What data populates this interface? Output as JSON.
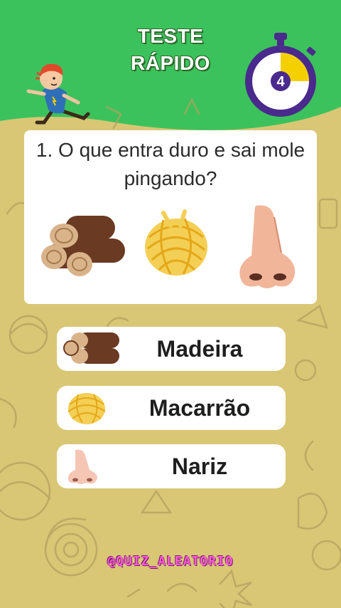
{
  "header": {
    "title_line1": "TESTE",
    "title_line2": "RÁPIDO"
  },
  "timer": {
    "value": "4",
    "progress": 0.25,
    "ring_color": "#4a2a8c",
    "fill_color": "#f5d000"
  },
  "question": {
    "text": "1. O que entra duro e sai mole pingando?",
    "images": [
      "wood-logs",
      "spaghetti-nest",
      "nose"
    ]
  },
  "answers": [
    {
      "label": "Madeira",
      "icon": "wood-logs-icon"
    },
    {
      "label": "Macarrão",
      "icon": "spaghetti-icon"
    },
    {
      "label": "Nariz",
      "icon": "nose-icon"
    }
  ],
  "watermark": "@QUIZ_ALEATORIO",
  "colors": {
    "header_green": "#3cc25c",
    "background_tan": "#d9c776",
    "doodle_line": "#b3a15e",
    "card": "#ffffff",
    "watermark": "#ff5fd8"
  }
}
